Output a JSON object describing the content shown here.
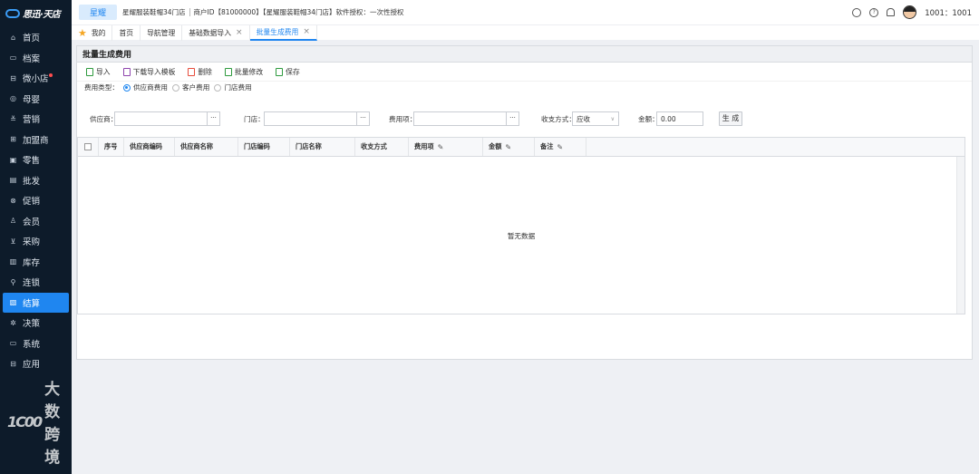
{
  "sidebar": {
    "logo_text": "思迅·天店",
    "items": [
      {
        "label": "首页",
        "icon": "home-icon",
        "glyph": "⌂"
      },
      {
        "label": "档案",
        "icon": "folder-icon",
        "glyph": "▭"
      },
      {
        "label": "微小店",
        "icon": "shop-icon",
        "glyph": "⊟",
        "dot": true
      },
      {
        "label": "母婴",
        "icon": "eye-icon",
        "glyph": "◎"
      },
      {
        "label": "营销",
        "icon": "marketing-icon",
        "glyph": "≚"
      },
      {
        "label": "加盟商",
        "icon": "franchise-icon",
        "glyph": "⊞"
      },
      {
        "label": "零售",
        "icon": "retail-icon",
        "glyph": "▣"
      },
      {
        "label": "批发",
        "icon": "wholesale-icon",
        "glyph": "▤"
      },
      {
        "label": "促销",
        "icon": "promotion-icon",
        "glyph": "⊗"
      },
      {
        "label": "会员",
        "icon": "member-icon",
        "glyph": "♙"
      },
      {
        "label": "采购",
        "icon": "cart-icon",
        "glyph": "⊻"
      },
      {
        "label": "库存",
        "icon": "inventory-icon",
        "glyph": "▥"
      },
      {
        "label": "连锁",
        "icon": "chain-icon",
        "glyph": "⚲"
      },
      {
        "label": "结算",
        "icon": "settlement-icon",
        "glyph": "▧",
        "active": true
      },
      {
        "label": "决策",
        "icon": "decision-icon",
        "glyph": "✲"
      },
      {
        "label": "系统",
        "icon": "system-icon",
        "glyph": "▭"
      },
      {
        "label": "应用",
        "icon": "app-icon",
        "glyph": "⊟"
      }
    ],
    "watermark": "大数跨境",
    "watermark_mark": "1C00"
  },
  "header": {
    "brand_tab": "星耀",
    "store_name": "星耀服装鞋帽34门店",
    "merchant_id": "商户ID【81000000】【星耀服装鞋帽34门店】软件授权：一次性授权",
    "user": "1001：1001"
  },
  "tabs": [
    {
      "label": "我的",
      "icon": "star-icon"
    },
    {
      "label": "首页"
    },
    {
      "label": "导航管理"
    },
    {
      "label": "基础数据导入",
      "closable": true
    },
    {
      "label": "批量生成费用",
      "closable": true,
      "active": true
    }
  ],
  "panel": {
    "title": "批量生成费用",
    "toolbar": [
      {
        "label": "导入",
        "icon": "import-icon",
        "color": "#2e9a3e"
      },
      {
        "label": "下载导入模板",
        "icon": "download-icon",
        "color": "#8e44ad"
      },
      {
        "label": "删除",
        "icon": "delete-icon",
        "color": "#e74c3c"
      },
      {
        "label": "批量修改",
        "icon": "edit-icon",
        "color": "#2e9a3e"
      },
      {
        "label": "保存",
        "icon": "save-icon",
        "color": "#2e9a3e"
      }
    ],
    "fee_type_label": "费用类型：",
    "fee_types": [
      "供应商费用",
      "客户费用",
      "门店费用"
    ],
    "filters": {
      "supplier_label": "供应商：",
      "store_label": "门店：",
      "item_label": "费用项：",
      "payment_label": "收支方式：",
      "payment_value": "应收",
      "amount_label": "金额：",
      "amount_value": "0.00",
      "generate_label": "生 成"
    },
    "table": {
      "columns": [
        "序号",
        "供应商编码",
        "供应商名称",
        "门店编码",
        "门店名称",
        "收支方式",
        "费用项",
        "金额",
        "备注"
      ],
      "empty_text": "暂无数据"
    }
  }
}
